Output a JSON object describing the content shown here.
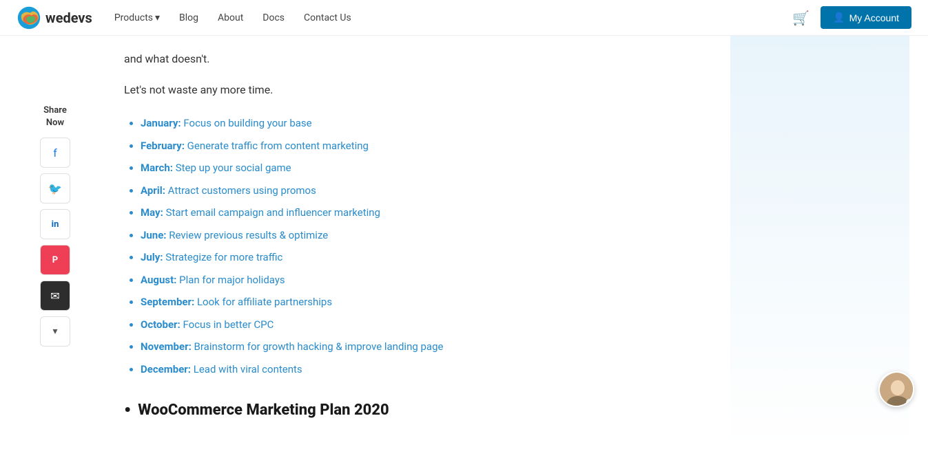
{
  "nav": {
    "logo_text": "wedevs",
    "links": [
      {
        "label": "Products",
        "has_dropdown": true
      },
      {
        "label": "Blog",
        "has_dropdown": false
      },
      {
        "label": "About",
        "has_dropdown": false
      },
      {
        "label": "Docs",
        "has_dropdown": false
      },
      {
        "label": "Contact Us",
        "has_dropdown": false
      }
    ],
    "my_account_label": "My Account"
  },
  "share": {
    "label": "Share\nNow"
  },
  "content": {
    "intro_text": "and what doesn't.",
    "intro_text2": "Let's not waste any more time.",
    "months": [
      {
        "label": "January:",
        "desc": "Focus on building your base"
      },
      {
        "label": "February:",
        "desc": "Generate traffic from content marketing"
      },
      {
        "label": "March:",
        "desc": "Step up your social game"
      },
      {
        "label": "April:",
        "desc": "Attract customers using promos"
      },
      {
        "label": "May:",
        "desc": "Start email campaign and influencer marketing"
      },
      {
        "label": "June:",
        "desc": "Review previous results & optimize"
      },
      {
        "label": "July:",
        "desc": "Strategize for more traffic"
      },
      {
        "label": "August:",
        "desc": "Plan for major holidays"
      },
      {
        "label": "September:",
        "desc": "Look for affiliate partnerships"
      },
      {
        "label": "October:",
        "desc": "Focus in better CPC"
      },
      {
        "label": "November:",
        "desc": "Brainstorm for growth hacking & improve landing page"
      },
      {
        "label": "December:",
        "desc": "Lead with viral contents"
      }
    ],
    "section_heading": "WooCommerce Marketing Plan 2020"
  }
}
